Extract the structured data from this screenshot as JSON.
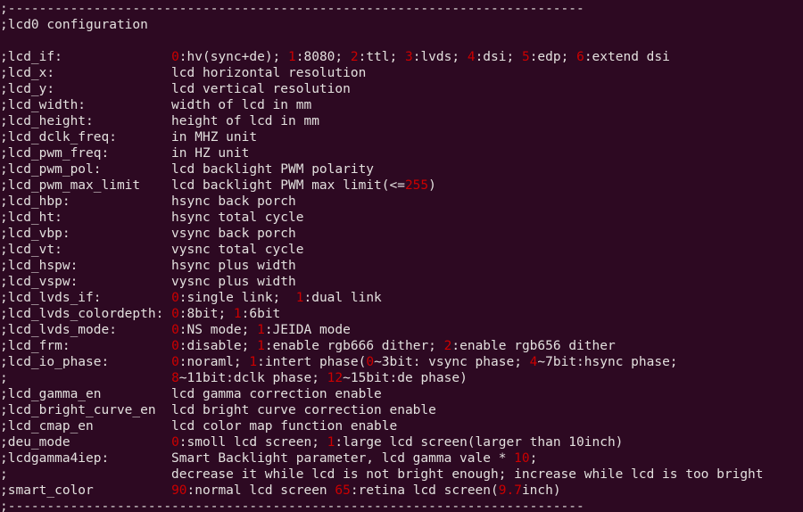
{
  "window": {
    "kind": "terminal-text-viewer",
    "background_color": "#2d0922",
    "foreground_color": "#e3e0de",
    "accent_color": "#cc0000",
    "columns": 98,
    "rows": 32
  },
  "document": {
    "section_title": ";lcd0 configuration",
    "separator": ";--------------------------------------------------------------------------",
    "comment_prefix": ";"
  },
  "lines": [
    {
      "id": "sep-top",
      "segments": [
        {
          "t": ";--------------------------------------------------------------------------",
          "c": "txt"
        }
      ]
    },
    {
      "id": "title",
      "segments": [
        {
          "t": ";lcd0 configuration",
          "c": "txt"
        }
      ]
    },
    {
      "id": "blank-1",
      "segments": [
        {
          "t": "",
          "c": "txt"
        }
      ]
    },
    {
      "id": "lcd_if",
      "segments": [
        {
          "t": ";lcd_if:              ",
          "c": "txt"
        },
        {
          "t": "0",
          "c": "num"
        },
        {
          "t": ":hv(sync+de); ",
          "c": "txt"
        },
        {
          "t": "1",
          "c": "num"
        },
        {
          "t": ":8080; ",
          "c": "txt"
        },
        {
          "t": "2",
          "c": "num"
        },
        {
          "t": ":ttl; ",
          "c": "txt"
        },
        {
          "t": "3",
          "c": "num"
        },
        {
          "t": ":lvds; ",
          "c": "txt"
        },
        {
          "t": "4",
          "c": "num"
        },
        {
          "t": ":dsi; ",
          "c": "txt"
        },
        {
          "t": "5",
          "c": "num"
        },
        {
          "t": ":edp; ",
          "c": "txt"
        },
        {
          "t": "6",
          "c": "num"
        },
        {
          "t": ":extend dsi",
          "c": "txt"
        }
      ]
    },
    {
      "id": "lcd_x",
      "segments": [
        {
          "t": ";lcd_x:               lcd horizontal resolution",
          "c": "txt"
        }
      ]
    },
    {
      "id": "lcd_y",
      "segments": [
        {
          "t": ";lcd_y:               lcd vertical resolution",
          "c": "txt"
        }
      ]
    },
    {
      "id": "lcd_width",
      "segments": [
        {
          "t": ";lcd_width:           width of lcd in mm",
          "c": "txt"
        }
      ]
    },
    {
      "id": "lcd_height",
      "segments": [
        {
          "t": ";lcd_height:          height of lcd in mm",
          "c": "txt"
        }
      ]
    },
    {
      "id": "lcd_dclk_freq",
      "segments": [
        {
          "t": ";lcd_dclk_freq:       in MHZ unit",
          "c": "txt"
        }
      ]
    },
    {
      "id": "lcd_pwm_freq",
      "segments": [
        {
          "t": ";lcd_pwm_freq:        in HZ unit",
          "c": "txt"
        }
      ]
    },
    {
      "id": "lcd_pwm_pol",
      "segments": [
        {
          "t": ";lcd_pwm_pol:         lcd backlight PWM polarity",
          "c": "txt"
        }
      ]
    },
    {
      "id": "lcd_pwm_max_limit",
      "segments": [
        {
          "t": ";lcd_pwm_max_limit    lcd backlight PWM max limit(<=",
          "c": "txt"
        },
        {
          "t": "255",
          "c": "num"
        },
        {
          "t": ")",
          "c": "txt"
        }
      ]
    },
    {
      "id": "lcd_hbp",
      "segments": [
        {
          "t": ";lcd_hbp:             hsync back porch",
          "c": "txt"
        }
      ]
    },
    {
      "id": "lcd_ht",
      "segments": [
        {
          "t": ";lcd_ht:              hsync total cycle",
          "c": "txt"
        }
      ]
    },
    {
      "id": "lcd_vbp",
      "segments": [
        {
          "t": ";lcd_vbp:             vsync back porch",
          "c": "txt"
        }
      ]
    },
    {
      "id": "lcd_vt",
      "segments": [
        {
          "t": ";lcd_vt:              vysnc total cycle",
          "c": "txt"
        }
      ]
    },
    {
      "id": "lcd_hspw",
      "segments": [
        {
          "t": ";lcd_hspw:            hsync plus width",
          "c": "txt"
        }
      ]
    },
    {
      "id": "lcd_vspw",
      "segments": [
        {
          "t": ";lcd_vspw:            vysnc plus width",
          "c": "txt"
        }
      ]
    },
    {
      "id": "lcd_lvds_if",
      "segments": [
        {
          "t": ";lcd_lvds_if:         ",
          "c": "txt"
        },
        {
          "t": "0",
          "c": "num"
        },
        {
          "t": ":single link;  ",
          "c": "txt"
        },
        {
          "t": "1",
          "c": "num"
        },
        {
          "t": ":dual link",
          "c": "txt"
        }
      ]
    },
    {
      "id": "lcd_lvds_colordepth",
      "segments": [
        {
          "t": ";lcd_lvds_colordepth: ",
          "c": "txt"
        },
        {
          "t": "0",
          "c": "num"
        },
        {
          "t": ":8bit; ",
          "c": "txt"
        },
        {
          "t": "1",
          "c": "num"
        },
        {
          "t": ":6bit",
          "c": "txt"
        }
      ]
    },
    {
      "id": "lcd_lvds_mode",
      "segments": [
        {
          "t": ";lcd_lvds_mode:       ",
          "c": "txt"
        },
        {
          "t": "0",
          "c": "num"
        },
        {
          "t": ":NS mode; ",
          "c": "txt"
        },
        {
          "t": "1",
          "c": "num"
        },
        {
          "t": ":JEIDA mode",
          "c": "txt"
        }
      ]
    },
    {
      "id": "lcd_frm",
      "segments": [
        {
          "t": ";lcd_frm:             ",
          "c": "txt"
        },
        {
          "t": "0",
          "c": "num"
        },
        {
          "t": ":disable; ",
          "c": "txt"
        },
        {
          "t": "1",
          "c": "num"
        },
        {
          "t": ":enable rgb666 dither; ",
          "c": "txt"
        },
        {
          "t": "2",
          "c": "num"
        },
        {
          "t": ":enable rgb656 dither",
          "c": "txt"
        }
      ]
    },
    {
      "id": "lcd_io_phase",
      "segments": [
        {
          "t": ";lcd_io_phase:        ",
          "c": "txt"
        },
        {
          "t": "0",
          "c": "num"
        },
        {
          "t": ":noraml; ",
          "c": "txt"
        },
        {
          "t": "1",
          "c": "num"
        },
        {
          "t": ":intert phase(",
          "c": "txt"
        },
        {
          "t": "0",
          "c": "num"
        },
        {
          "t": "~3bit: vsync phase; ",
          "c": "txt"
        },
        {
          "t": "4",
          "c": "num"
        },
        {
          "t": "~7bit:hsync phase;",
          "c": "txt"
        }
      ]
    },
    {
      "id": "lcd_io_phase_cont",
      "segments": [
        {
          "t": ";                     ",
          "c": "txt"
        },
        {
          "t": "8",
          "c": "num"
        },
        {
          "t": "~11bit:dclk phase; ",
          "c": "txt"
        },
        {
          "t": "12",
          "c": "num"
        },
        {
          "t": "~15bit:de phase)",
          "c": "txt"
        }
      ]
    },
    {
      "id": "lcd_gamma_en",
      "segments": [
        {
          "t": ";lcd_gamma_en         lcd gamma correction enable",
          "c": "txt"
        }
      ]
    },
    {
      "id": "lcd_bright_curve_en",
      "segments": [
        {
          "t": ";lcd_bright_curve_en  lcd bright curve correction enable",
          "c": "txt"
        }
      ]
    },
    {
      "id": "lcd_cmap_en",
      "segments": [
        {
          "t": ";lcd_cmap_en          lcd color map function enable",
          "c": "txt"
        }
      ]
    },
    {
      "id": "deu_mode",
      "segments": [
        {
          "t": ";deu_mode             ",
          "c": "txt"
        },
        {
          "t": "0",
          "c": "num"
        },
        {
          "t": ":smoll lcd screen; ",
          "c": "txt"
        },
        {
          "t": "1",
          "c": "num"
        },
        {
          "t": ":large lcd screen(larger than 10inch)",
          "c": "txt"
        }
      ]
    },
    {
      "id": "lcdgamma4iep",
      "segments": [
        {
          "t": ";lcdgamma4iep:        Smart Backlight parameter, lcd gamma vale * ",
          "c": "txt"
        },
        {
          "t": "10",
          "c": "num"
        },
        {
          "t": ";",
          "c": "txt"
        }
      ]
    },
    {
      "id": "lcdgamma4iep_cont",
      "segments": [
        {
          "t": ";                     decrease it while lcd is not bright enough; increase while lcd is too bright",
          "c": "txt"
        }
      ]
    },
    {
      "id": "smart_color",
      "segments": [
        {
          "t": ";smart_color          ",
          "c": "txt"
        },
        {
          "t": "90",
          "c": "num"
        },
        {
          "t": ":normal lcd screen ",
          "c": "txt"
        },
        {
          "t": "65",
          "c": "num"
        },
        {
          "t": ":retina lcd screen(",
          "c": "txt"
        },
        {
          "t": "9.7",
          "c": "num"
        },
        {
          "t": "inch)",
          "c": "txt"
        }
      ]
    },
    {
      "id": "sep-bottom",
      "segments": [
        {
          "t": ";--------------------------------------------------------------------------",
          "c": "txt"
        }
      ]
    }
  ]
}
